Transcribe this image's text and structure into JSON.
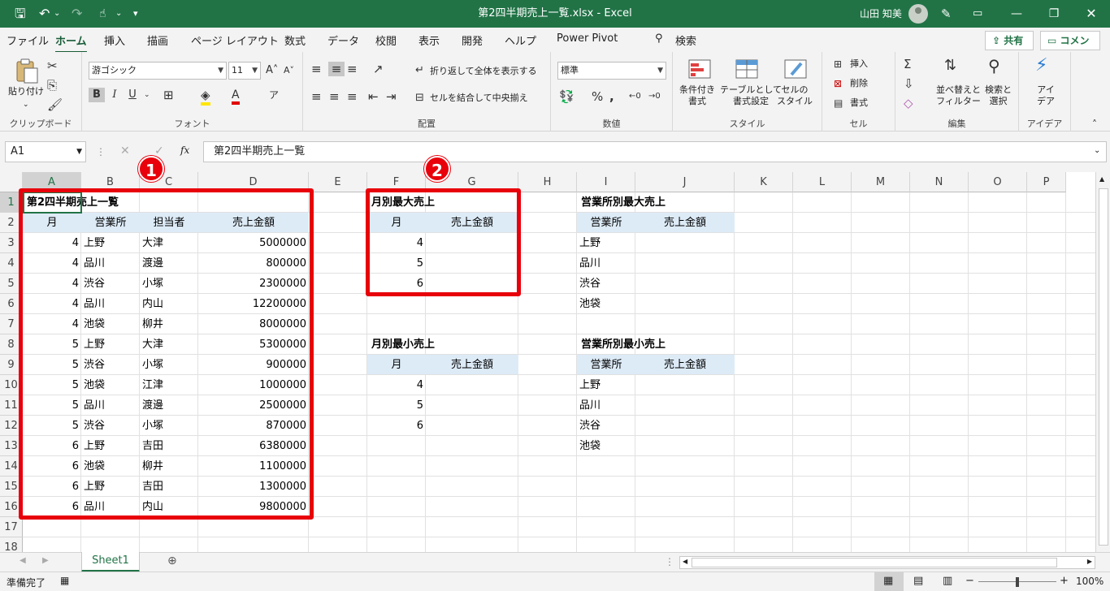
{
  "titlebar": {
    "doc_title": "第2四半期売上一覧.xlsx  -  Excel",
    "user_name": "山田 知美",
    "icons": [
      "save-icon",
      "undo-icon",
      "redo-icon",
      "touch-mode-icon",
      "customize-icon",
      "pen-icon",
      "ribbon-display-icon",
      "minimize-icon",
      "restore-icon",
      "close-icon"
    ]
  },
  "menu": {
    "tabs": [
      "ファイル",
      "ホーム",
      "挿入",
      "描画",
      "ページ レイアウト",
      "数式",
      "データ",
      "校閲",
      "表示",
      "開発",
      "ヘルプ",
      "Power Pivot"
    ],
    "active": "ホーム",
    "search": "検索",
    "share": "共有",
    "comment": "コメント"
  },
  "ribbon": {
    "clipboard": {
      "paste": "貼り付け",
      "label": "クリップボード"
    },
    "font": {
      "name": "游ゴシック",
      "size": "11",
      "bold": "B",
      "italic": "I",
      "underline": "U",
      "label": "フォント"
    },
    "alignment": {
      "wrap": "折り返して全体を表示する",
      "merge": "セルを結合して中央揃え",
      "label": "配置"
    },
    "number": {
      "format": "標準",
      "label": "数値"
    },
    "styles": {
      "conditional": "条件付き\n書式",
      "table": "テーブルとして\n書式設定",
      "cell": "セルの\nスタイル",
      "label": "スタイル"
    },
    "cells": {
      "insert": "挿入",
      "delete": "削除",
      "format": "書式",
      "label": "セル"
    },
    "editing": {
      "sort": "並べ替えと\nフィルター",
      "find": "検索と\n選択",
      "label": "編集"
    },
    "ideas": {
      "btn": "アイ\nデア",
      "label": "アイデア"
    }
  },
  "formula": {
    "namebox": "A1",
    "fx": "fx",
    "content": "第2四半期売上一覧"
  },
  "columns": [
    "A",
    "B",
    "C",
    "D",
    "E",
    "F",
    "G",
    "H",
    "I",
    "J",
    "K",
    "L",
    "M",
    "N",
    "O",
    "P"
  ],
  "rows": [
    "1",
    "2",
    "3",
    "4",
    "5",
    "6",
    "7",
    "8",
    "9",
    "10",
    "11",
    "12",
    "13",
    "14",
    "15",
    "16",
    "17",
    "18"
  ],
  "sheet": {
    "title": "第2四半期売上一覧",
    "headers": [
      "月",
      "営業所",
      "担当者",
      "売上金額"
    ],
    "data": [
      [
        "4",
        "上野",
        "大津",
        "5000000"
      ],
      [
        "4",
        "品川",
        "渡邊",
        "800000"
      ],
      [
        "4",
        "渋谷",
        "小塚",
        "2300000"
      ],
      [
        "4",
        "品川",
        "内山",
        "12200000"
      ],
      [
        "4",
        "池袋",
        "柳井",
        "8000000"
      ],
      [
        "5",
        "上野",
        "大津",
        "5300000"
      ],
      [
        "5",
        "渋谷",
        "小塚",
        "900000"
      ],
      [
        "5",
        "池袋",
        "江津",
        "1000000"
      ],
      [
        "5",
        "品川",
        "渡邊",
        "2500000"
      ],
      [
        "5",
        "渋谷",
        "小塚",
        "870000"
      ],
      [
        "6",
        "上野",
        "吉田",
        "6380000"
      ],
      [
        "6",
        "池袋",
        "柳井",
        "1100000"
      ],
      [
        "6",
        "上野",
        "吉田",
        "1300000"
      ],
      [
        "6",
        "品川",
        "内山",
        "9800000"
      ]
    ],
    "monthly_max": {
      "title": "月別最大売上",
      "headers": [
        "月",
        "売上金額"
      ],
      "months": [
        "4",
        "5",
        "6"
      ]
    },
    "monthly_min": {
      "title": "月別最小売上",
      "headers": [
        "月",
        "売上金額"
      ],
      "months": [
        "4",
        "5",
        "6"
      ]
    },
    "branch_max": {
      "title": "営業所別最大売上",
      "headers": [
        "営業所",
        "売上金額"
      ],
      "branches": [
        "上野",
        "品川",
        "渋谷",
        "池袋"
      ]
    },
    "branch_min": {
      "title": "営業所別最小売上",
      "headers": [
        "営業所",
        "売上金額"
      ],
      "branches": [
        "上野",
        "品川",
        "渋谷",
        "池袋"
      ]
    }
  },
  "annotations": {
    "badge1": "1",
    "badge2": "2",
    "color": "#e8000b"
  },
  "sheet_tabs": {
    "active": "Sheet1"
  },
  "status": {
    "ready": "準備完了",
    "zoom": "100%"
  }
}
